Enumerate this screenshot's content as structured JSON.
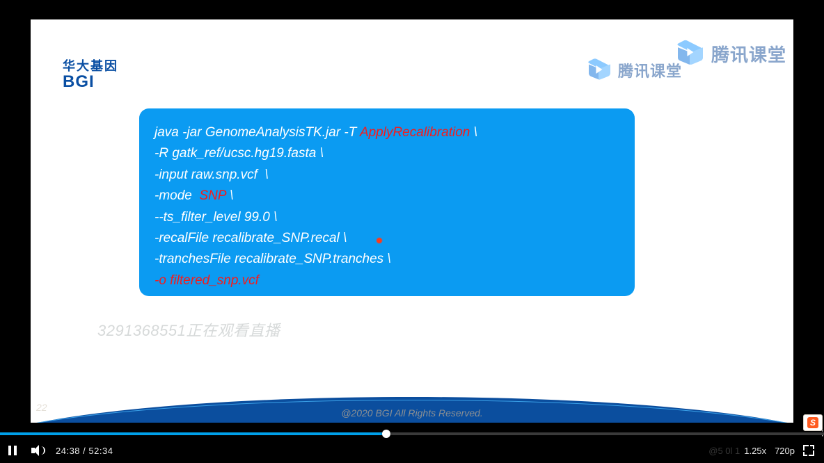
{
  "logo": {
    "cn": "华大基因",
    "en": "BGI"
  },
  "watermark": {
    "text": "腾讯课堂"
  },
  "cmd": {
    "l1a": "java -jar GenomeAnalysisTK.jar -T ",
    "l1b": "ApplyRecalibration",
    "l1c": " \\",
    "l2": "-R gatk_ref/ucsc.hg19.fasta \\",
    "l3": "-input raw.snp.vcf  \\",
    "l4a": "-mode  ",
    "l4b": "SNP",
    "l4c": " \\",
    "l5": "--ts_filter_level 99.0 \\",
    "l6": "-recalFile recalibrate_SNP.recal \\",
    "l7": "-tranchesFile recalibrate_SNP.tranches \\",
    "l8": "-o filtered_snp.vcf"
  },
  "viewer_faint": "3291368551正在观看直播",
  "page_faint": "22",
  "copyright": "@2020 BGI All Rights Reserved.",
  "player": {
    "current": "24:38",
    "sep": " / ",
    "total": "52:34",
    "progress_pct": 46.9,
    "speed": "1.25x",
    "quality": "720p",
    "overlay_id": "@5  0l 1"
  },
  "badge": {
    "letter": "S"
  }
}
